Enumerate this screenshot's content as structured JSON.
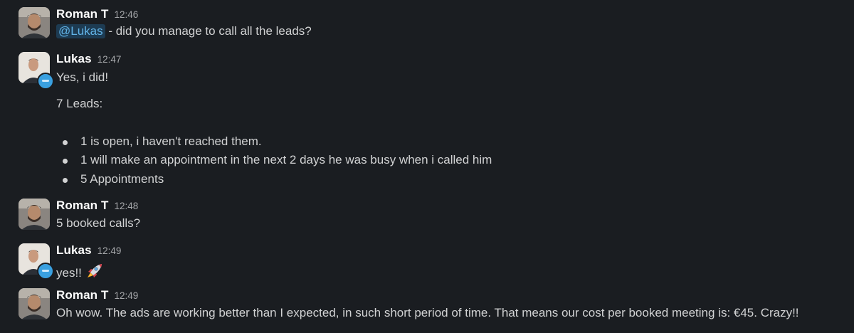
{
  "messages": [
    {
      "author": "Roman T",
      "time": "12:46",
      "mention": "@Lukas",
      "text": " - did you manage to call all the leads?"
    },
    {
      "author": "Lukas",
      "time": "12:47",
      "line1": "Yes, i did!",
      "line2": "7 Leads:",
      "bullets": [
        "1 is open, i haven't reached them.",
        "1 will make an appointment in the next 2 days he was busy when i called him",
        "5 Appointments"
      ]
    },
    {
      "author": "Roman T",
      "time": "12:48",
      "text": "5 booked calls?"
    },
    {
      "author": "Lukas",
      "time": "12:49",
      "text": "yes!!",
      "emoji": "rocket-icon"
    },
    {
      "author": "Roman T",
      "time": "12:49",
      "text": "Oh wow. The ads are working better than I expected, in such short period of time. That means our cost per booked meeting is: €45. Crazy!!"
    }
  ],
  "colors": {
    "background": "#1a1d21",
    "text": "#d1d2d3",
    "name": "#ffffff",
    "timestamp": "#a6a8ab",
    "mention_bg": "#1d3b52",
    "mention_text": "#62b4e8",
    "status_badge": "#3aa0e0"
  }
}
